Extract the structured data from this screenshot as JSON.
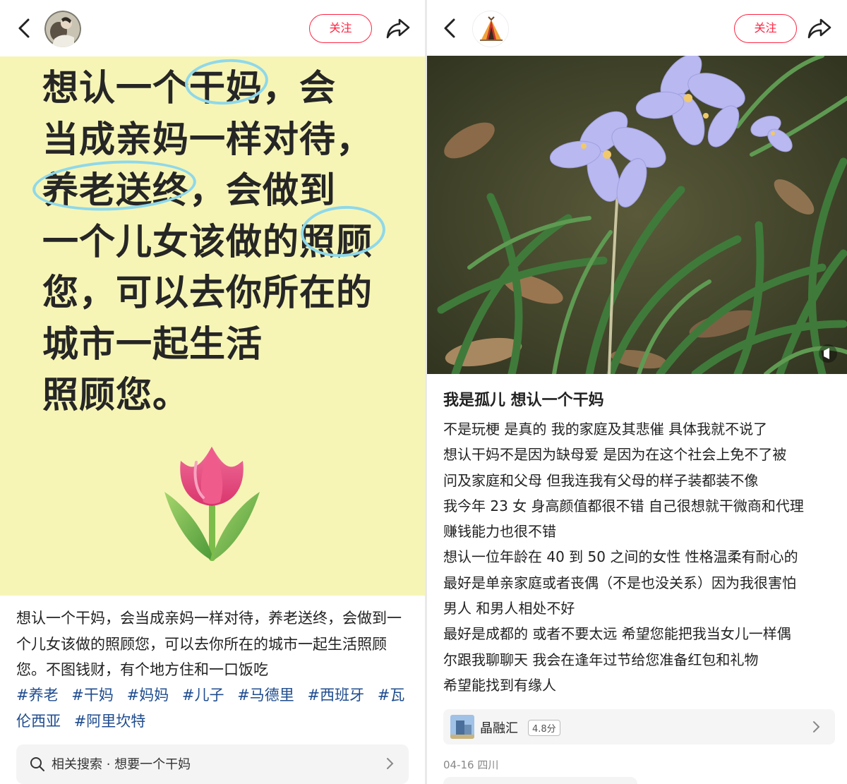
{
  "left_post": {
    "follow_label": "关注",
    "poster_lines": [
      "想认一个干妈，会",
      "当成亲妈一样对待，",
      "养老送终，会做到",
      "一个儿女该做的照顾",
      "您，可以去你所在的",
      "城市一起生活",
      "照顾您。"
    ],
    "caption": "想认一个干妈，会当成亲妈一样对待，养老送终，会做到一个儿女该做的照顾您，可以去你所在的城市一起生活照顾您。不图钱财，有个地方住和一口饭吃",
    "tags": [
      "#养老",
      "#干妈",
      "#妈妈",
      "#儿子",
      "#马德里",
      "#西班牙",
      "#瓦伦西亚",
      "#阿里坎特"
    ],
    "related_search": "相关搜索 · 想要一个干妈"
  },
  "right_post": {
    "follow_label": "关注",
    "title": "我是孤儿 想认一个干妈",
    "body_lines": [
      "不是玩梗 是真的 我的家庭及其悲催 具体我就不说了",
      "想认干妈不是因为缺母爱 是因为在这个社会上免不了被",
      "问及家庭和父母 但我连我有父母的样子装都装不像",
      "我今年 23 女 身高颜值都很不错 自己很想就干微商和代理",
      "赚钱能力也很不错",
      "想认一位年龄在 40 到 50 之间的女性 性格温柔有耐心的",
      "最好是单亲家庭或者丧偶（不是也没关系）因为我很害怕",
      "男人 和男人相处不好",
      "最好是成都的 或者不要太远 希望您能把我当女儿一样偶",
      "尔跟我聊聊天 我会在逢年过节给您准备红包和礼物",
      "希望能找到有缘人"
    ],
    "shop": {
      "name": "晶融汇",
      "score": "4.8分"
    },
    "date_location": "04-16 四川"
  },
  "colors": {
    "accent": "#ff2442",
    "poster_bg": "#f6f5b6",
    "hashtag": "#1f4c8f",
    "highlight_circle": "#8fd8ea"
  },
  "icons": [
    "back-arrow-icon",
    "share-icon",
    "search-icon",
    "chevron-right-icon",
    "tulip-emoji",
    "camping-tent-avatar"
  ]
}
